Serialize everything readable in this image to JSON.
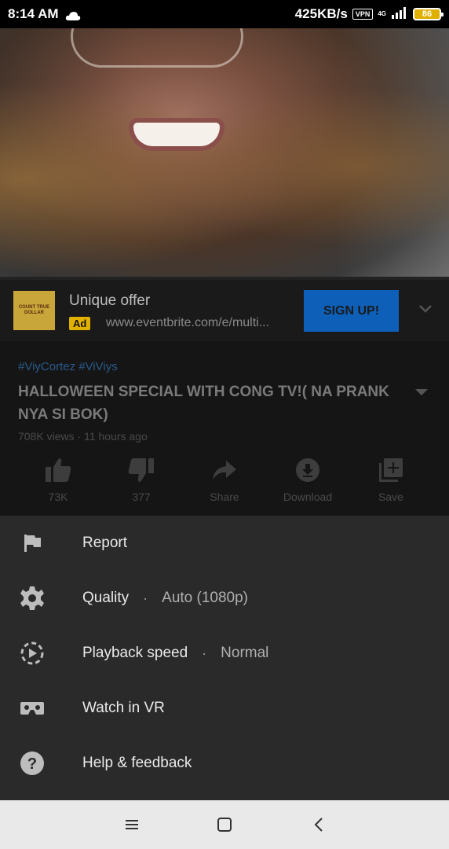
{
  "status_bar": {
    "time": "8:14 AM",
    "speed": "425KB/s",
    "vpn": "VPN",
    "network": "4G",
    "battery": "86"
  },
  "video": {
    "progress": 0.0,
    "progress_color": "#ff0000"
  },
  "ad": {
    "logo_text": "COUNT TRUE DOLLAR",
    "title": "Unique offer",
    "badge": "Ad",
    "url": "www.eventbrite.com/e/multi...",
    "cta": "SIGN UP!",
    "cta_color": "#0d5fb8"
  },
  "info": {
    "hashtags": "#ViyCortez #ViViys",
    "title": "HALLOWEEN SPECIAL WITH CONG TV!( NA PRANK NYA SI BOK)",
    "meta": "708K views · 11 hours ago",
    "actions": [
      {
        "label": "73K",
        "icon": "thumbs-up-icon"
      },
      {
        "label": "377",
        "icon": "thumbs-down-icon"
      },
      {
        "label": "Share",
        "icon": "share-icon"
      },
      {
        "label": "Download",
        "icon": "download-icon"
      },
      {
        "label": "Save",
        "icon": "add-to-playlist-icon"
      }
    ]
  },
  "menu": {
    "items": [
      {
        "label": "Report",
        "icon": "flag-icon"
      },
      {
        "label": "Quality",
        "value": "Auto (1080p)",
        "icon": "gear-icon"
      },
      {
        "label": "Playback speed",
        "value": "Normal",
        "icon": "playback-speed-icon"
      },
      {
        "label": "Watch in VR",
        "icon": "vr-headset-icon"
      },
      {
        "label": "Help & feedback",
        "icon": "help-icon"
      }
    ],
    "separator": "·"
  }
}
